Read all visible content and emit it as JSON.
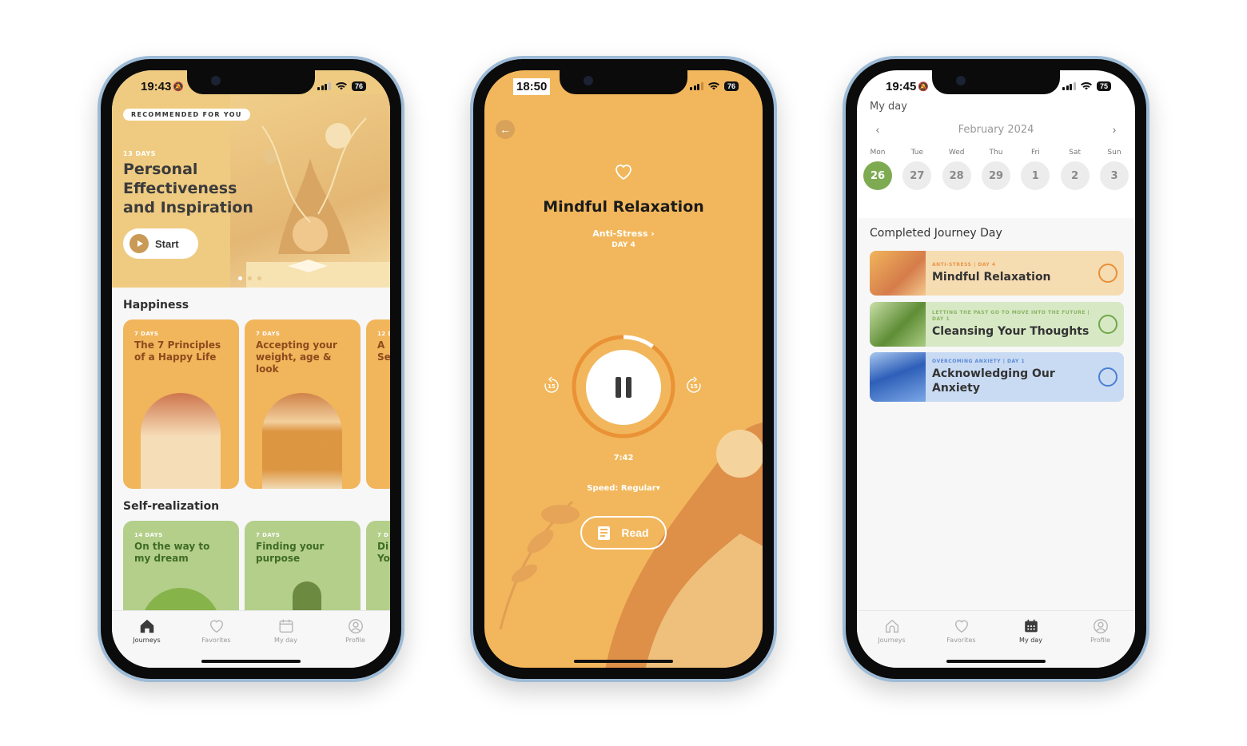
{
  "screen_journeys": {
    "status": {
      "time": "19:43",
      "battery": "76"
    },
    "hero": {
      "badge": "RECOMMENDED FOR YOU",
      "days": "13 DAYS",
      "title": "Personal Effectiveness and Inspiration",
      "start_label": "Start",
      "carousel_pages": 3,
      "carousel_active": 1
    },
    "sections": [
      {
        "title": "Happiness",
        "cards": [
          {
            "days": "7 DAYS",
            "title": "The 7 Principles of a Happy Life"
          },
          {
            "days": "7 DAYS",
            "title": "Accepting your weight, age & look"
          },
          {
            "days": "12 D",
            "title": "A Se"
          }
        ]
      },
      {
        "title": "Self-realization",
        "cards": [
          {
            "days": "14 DAYS",
            "title": "On the way to my dream"
          },
          {
            "days": "7 DAYS",
            "title": "Finding your purpose"
          },
          {
            "days": "7 D",
            "title": "Di Yo"
          }
        ]
      }
    ],
    "tabbar": [
      {
        "label": "Journeys",
        "icon": "home-icon",
        "active": true
      },
      {
        "label": "Favorites",
        "icon": "heart-icon",
        "active": false
      },
      {
        "label": "My day",
        "icon": "calendar-icon",
        "active": false
      },
      {
        "label": "Profile",
        "icon": "user-icon",
        "active": false
      }
    ]
  },
  "screen_player": {
    "status": {
      "time": "18:50",
      "battery": "76"
    },
    "title": "Mindful Relaxation",
    "journey": "Anti-Stress ›",
    "day": "DAY 4",
    "progress_fraction": 0.1,
    "elapsed": "7:42",
    "skip_back_label": "15",
    "skip_forward_label": "15",
    "speed_label": "Speed:",
    "speed_value": "Regular▾",
    "read_label": "Read"
  },
  "screen_myday": {
    "status": {
      "time": "19:45",
      "battery": "75"
    },
    "page_label": "My day",
    "month": "February 2024",
    "week": [
      {
        "day": "Mon",
        "date": "26",
        "selected": true
      },
      {
        "day": "Tue",
        "date": "27",
        "selected": false
      },
      {
        "day": "Wed",
        "date": "28",
        "selected": false
      },
      {
        "day": "Thu",
        "date": "29",
        "selected": false
      },
      {
        "day": "Fri",
        "date": "1",
        "selected": false
      },
      {
        "day": "Sat",
        "date": "2",
        "selected": false
      },
      {
        "day": "Sun",
        "date": "3",
        "selected": false
      }
    ],
    "completed_title": "Completed Journey Day",
    "completed": [
      {
        "meta": "ANTI-STRESS  |  DAY 4",
        "title": "Mindful Relaxation",
        "bg": "#f6dcb1",
        "accent": "#e88f38",
        "meta_color": "#e8984a"
      },
      {
        "meta": "LETTING THE PAST GO TO MOVE INTO THE FUTURE  |  DAY 1",
        "title": "Cleansing Your Thoughts",
        "bg": "#d7e8c4",
        "accent": "#6fa84a",
        "meta_color": "#8ab566"
      },
      {
        "meta": "OVERCOMING ANXIETY  |  DAY 1",
        "title": "Acknowledging Our Anxiety",
        "bg": "#c9dbf3",
        "accent": "#4a7fd4",
        "meta_color": "#5b88d8"
      }
    ],
    "tabbar": [
      {
        "label": "Journeys",
        "icon": "home-icon",
        "active": false
      },
      {
        "label": "Favorites",
        "icon": "heart-icon",
        "active": false
      },
      {
        "label": "My day",
        "icon": "calendar-icon",
        "active": true
      },
      {
        "label": "Profile",
        "icon": "user-icon",
        "active": false
      }
    ]
  },
  "colors": {
    "hero_bg": "#efcb82",
    "player_bg": "#f2b75c",
    "happiness_card": "#f1b55c",
    "self_realization_card": "#b3cf8a",
    "selected_day": "#7eab52",
    "progress_ring": "#ea9236"
  }
}
